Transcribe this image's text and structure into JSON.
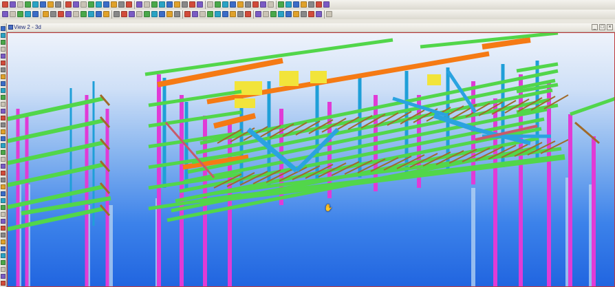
{
  "view": {
    "title": "View 2 - 3d"
  },
  "window_controls": {
    "minimize": "_",
    "maximize": "□",
    "close": "×"
  },
  "colors": {
    "column": "#e03bd6",
    "column_blue": "#1f9fd8",
    "beam": "#52d64a",
    "beam_orange": "#f57a14",
    "brace": "#2aa3e0",
    "brown_member": "#a06a2a",
    "yellow_plate": "#f2e43a",
    "viewport_border": "#c0393b",
    "background_top": "#eef3fb",
    "background_bottom": "#2165e0"
  },
  "icons": {
    "toolbar": "toolbar-tool-icons",
    "cursor": "hand-cursor-icon",
    "view": "view-window-icon"
  }
}
